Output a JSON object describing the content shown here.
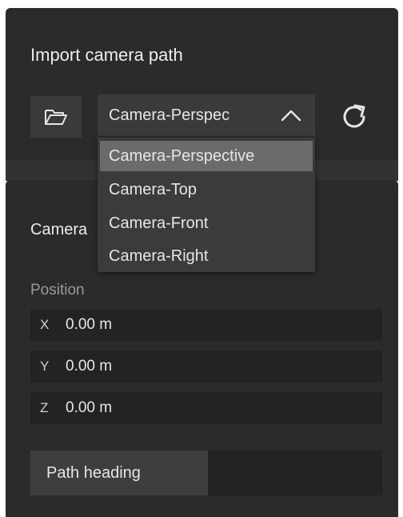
{
  "panel": {
    "title": "Import camera path",
    "icons": {
      "folder": "folder-icon",
      "chevron": "chevron-up-icon",
      "refresh": "refresh-icon"
    }
  },
  "camera_select": {
    "selected_label": "Camera-Perspec",
    "options": [
      "Camera-Perspective",
      "Camera-Top",
      "Camera-Front",
      "Camera-Right"
    ],
    "selected_option": "Camera-Perspective"
  },
  "camera_section": {
    "label": "Camera",
    "position_label": "Position",
    "fields": [
      {
        "axis": "X",
        "value": "0.00 m"
      },
      {
        "axis": "Y",
        "value": "0.00 m"
      },
      {
        "axis": "Z",
        "value": "0.00 m"
      }
    ]
  },
  "path_heading": {
    "label": "Path heading"
  },
  "colors": {
    "panel_bg": "#2b2b2b",
    "control_bg": "#3a3a3a",
    "field_bg": "#232323",
    "selected_bg": "#6b6b6b",
    "text": "#e6e6e6",
    "muted_text": "#9a9a9a"
  }
}
